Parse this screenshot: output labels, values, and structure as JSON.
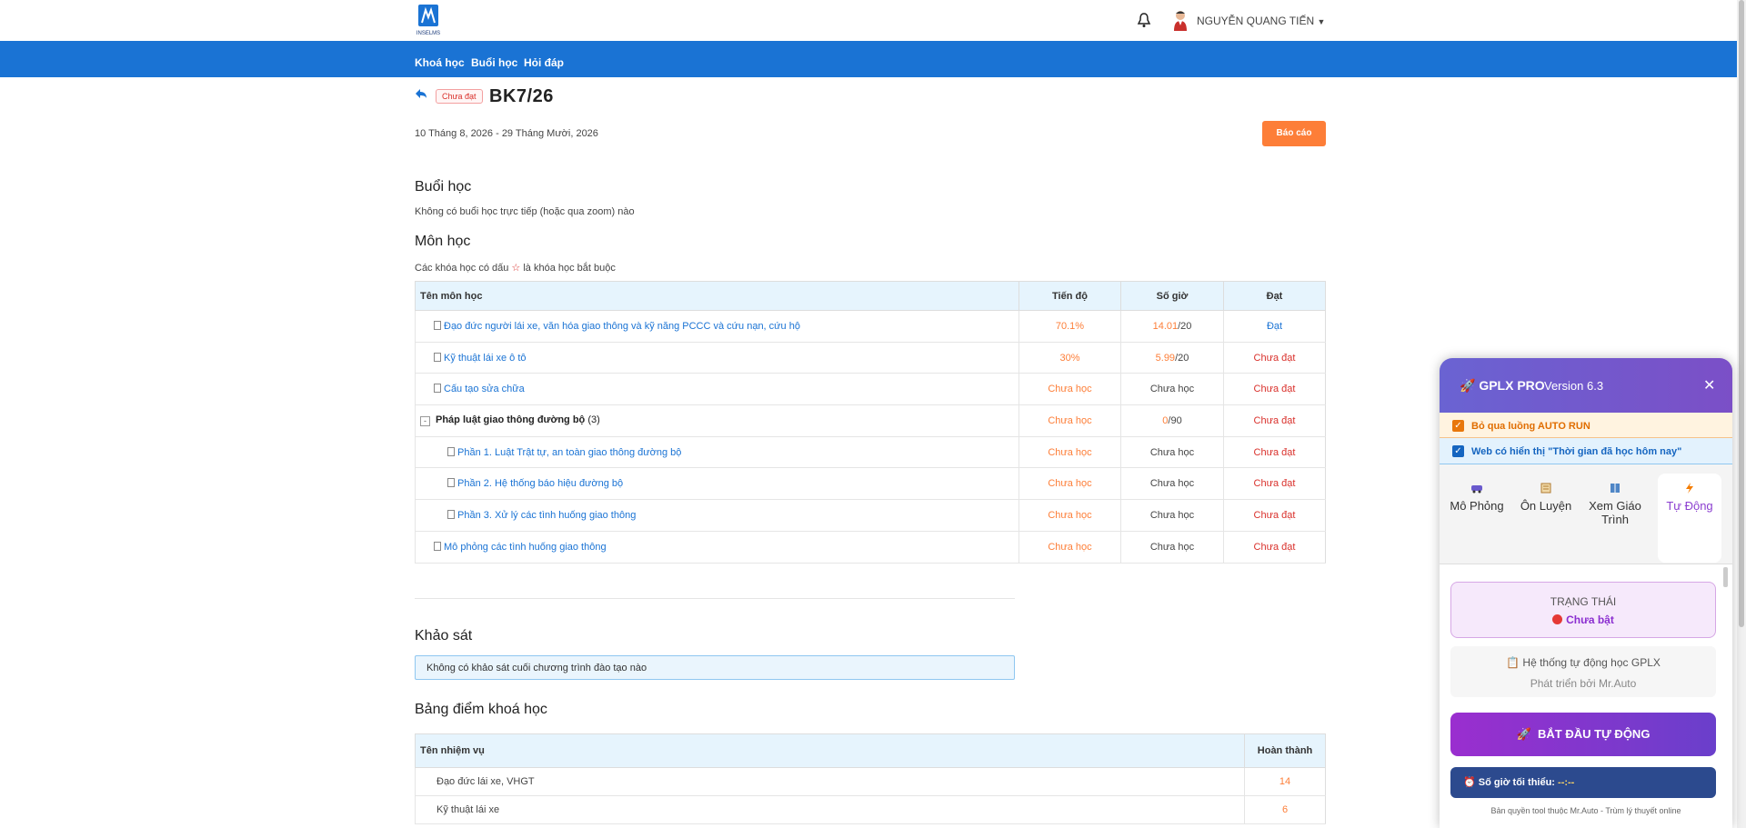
{
  "header": {
    "logo_text": "INSELMS",
    "user_name": "NGUYỄN QUANG TIẾN",
    "nav": [
      "Khoá học",
      "Buổi học",
      "Hỏi đáp"
    ]
  },
  "course": {
    "status_badge": "Chưa đạt",
    "title": "BK7/26",
    "dates": "10 Tháng 8, 2026 - 29 Tháng Mười, 2026",
    "report_button": "Báo cáo"
  },
  "sessions": {
    "heading": "Buổi học",
    "empty": "Không có buổi học trực tiếp (hoặc qua zoom) nào"
  },
  "subjects": {
    "heading": "Môn học",
    "note_before": "Các khóa học có dấu",
    "note_star": "☆",
    "note_after": "là khóa học bắt buộc",
    "columns": [
      "Tên môn học",
      "Tiến độ",
      "Số giờ",
      "Đạt"
    ],
    "rows": [
      {
        "name": "Đạo đức người lái xe, văn hóa giao thông và kỹ năng PCCC và cứu nạn, cứu hộ",
        "progress": "70.1%",
        "hours_done": "14.01",
        "hours_total": "/20",
        "hours_text": "",
        "pass": "Đạt",
        "pass_color": "#1a73d4"
      },
      {
        "name": "Kỹ thuật lái xe ô tô",
        "progress": "30%",
        "hours_done": "5.99",
        "hours_total": "/20",
        "hours_text": "",
        "pass": "Chưa đạt",
        "pass_color": "#d9302b"
      },
      {
        "name": "Cấu tạo sửa chữa",
        "progress": "Chưa học",
        "hours_done": "",
        "hours_total": "",
        "hours_text": "Chưa học",
        "pass": "Chưa đạt",
        "pass_color": "#d9302b"
      },
      {
        "name": "Pháp luật giao thông đường bộ",
        "count": "(3)",
        "group": true,
        "progress": "Chưa học",
        "hours_done": "0",
        "hours_total": "/90",
        "hours_text": "",
        "pass": "Chưa đạt",
        "pass_color": "#d9302b"
      },
      {
        "name": "Phần 1. Luật Trật tự, an toàn giao thông đường bộ",
        "child": true,
        "progress": "Chưa học",
        "hours_done": "",
        "hours_total": "",
        "hours_text": "Chưa học",
        "pass": "Chưa đạt",
        "pass_color": "#d9302b"
      },
      {
        "name": "Phần 2. Hệ thống báo hiệu đường bộ",
        "child": true,
        "progress": "Chưa học",
        "hours_done": "",
        "hours_total": "",
        "hours_text": "Chưa học",
        "pass": "Chưa đạt",
        "pass_color": "#d9302b"
      },
      {
        "name": "Phần 3. Xử lý các tình huống giao thông",
        "child": true,
        "progress": "Chưa học",
        "hours_done": "",
        "hours_total": "",
        "hours_text": "Chưa học",
        "pass": "Chưa đạt",
        "pass_color": "#d9302b"
      },
      {
        "name": "Mô phỏng các tình huống giao thông",
        "progress": "Chưa học",
        "hours_done": "",
        "hours_total": "",
        "hours_text": "Chưa học",
        "pass": "Chưa đạt",
        "pass_color": "#d9302b"
      }
    ]
  },
  "survey": {
    "heading": "Khảo sát",
    "empty": "Không có khảo sát cuối chương trình đào tạo nào"
  },
  "grades": {
    "heading": "Bảng điểm khoá học",
    "columns": [
      "Tên nhiệm vụ",
      "Hoàn thành"
    ],
    "rows": [
      {
        "task": "Đạo đức lái xe, VHGT",
        "done": "14"
      },
      {
        "task": "Kỹ thuật lái xe",
        "done": "6"
      }
    ]
  },
  "panel": {
    "title": "GPLX PRO",
    "version": "Version 6.3",
    "option1": "Bỏ qua luồng AUTO RUN",
    "option2": "Web có hiển thị \"Thời gian đã học hôm nay\"",
    "modes": [
      {
        "label": "Mô Phỏng",
        "icon": "car-icon"
      },
      {
        "label": "Ôn Luyện",
        "icon": "notebook-icon"
      },
      {
        "label": "Xem Giáo Trình",
        "icon": "book-icon"
      },
      {
        "label": "Tự Động",
        "icon": "lightning-icon",
        "active": true
      }
    ],
    "status_label": "TRẠNG THÁI",
    "status_value": "Chưa bật",
    "system_line": "Hệ thống tự động học GPLX",
    "developer_line": "Phát triển bởi Mr.Auto",
    "start_button": "BẮT ĐẦU TỰ ĐỘNG",
    "min_hours_label": "Số giờ tối thiểu:",
    "min_hours_value": "--:--",
    "copyright": "Bản quyền tool thuộc Mr.Auto - Trùm lý thuyết online"
  },
  "colors": {
    "nav_blue": "#1a73d4",
    "accent_orange": "#fd7e38",
    "error_red": "#d9302b",
    "panel_purple": "#7b4fc7"
  }
}
